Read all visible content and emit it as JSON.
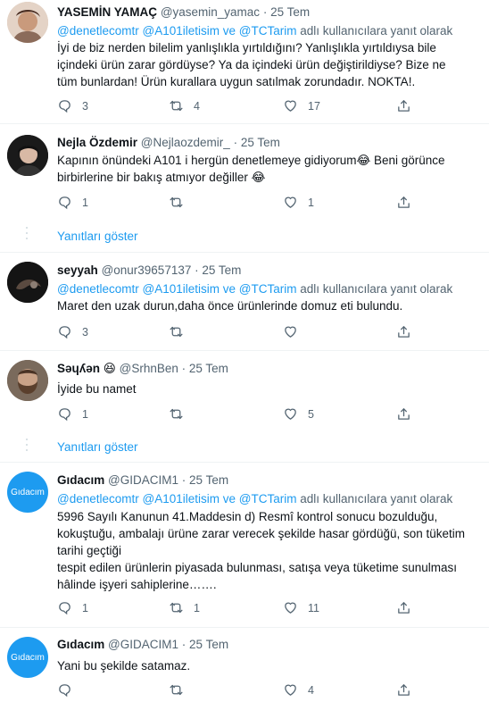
{
  "tweets": [
    {
      "name": "YASEMİN YAMAÇ",
      "handle": "@yasemin_yamac",
      "time": "25 Tem",
      "reply_prefix": "",
      "reply_links": "",
      "reply_suffix": "",
      "lines": [
        "İyi de biz nerden bilelim yanlışlıkla yırtıldığını? Yanlışlıkla yırtıldıysa bile",
        "içindeki ürün zarar gördüyse? Ya da içindeki ürün değiştirildiyse? Bize ne",
        "tüm bunlardan! Ürün kurallara uygun satılmak zorundadır. NOKTA!."
      ],
      "reply_count": "3",
      "retweet_count": "4",
      "like_count": "17"
    },
    {
      "name": "Nejla Özdemir",
      "handle": "@Nejlaozdemir_",
      "time": "25 Tem",
      "lines": [
        "Kapının önündeki A101 i hergün denetlemeye gidiyorum😂 Beni görünce",
        "birbirlerine bir bakış atmıyor değiller 😂"
      ],
      "reply_count": "1",
      "retweet_count": "",
      "like_count": "1"
    },
    {
      "name": "seyyah",
      "handle": "@onur39657137",
      "time": "25 Tem",
      "reply_links": "@denetlecomtr @A101iletisim ve @TCTarim",
      "reply_suffix": "adlı kullanıcılara yanıt olarak",
      "lines": [
        "Maret den uzak durun,daha önce ürünlerinde domuz eti bulundu."
      ],
      "reply_count": "3",
      "retweet_count": "",
      "like_count": ""
    },
    {
      "name": "Sәɥʎǝn 😆",
      "handle": "@SrhnBen",
      "time": "25 Tem",
      "lines": [
        "İyide bu namet"
      ],
      "reply_count": "1",
      "retweet_count": "",
      "like_count": "5"
    },
    {
      "name": "Gıdacım",
      "handle": "@GIDACIM1",
      "time": "25 Tem",
      "avatar_text": "Gıdacım",
      "reply_links": "@denetlecomtr @A101iletisim ve @TCTarim",
      "reply_suffix": "adlı kullanıcılara yanıt olarak",
      "lines": [
        "5996 Sayılı Kanunun 41.Maddesin d) Resmî kontrol sonucu bozulduğu,",
        "kokuştuğu, ambalajı ürüne zarar verecek şekilde hasar gördüğü, son tüketim",
        "tarihi geçtiği",
        "tespit edilen ürünlerin piyasada bulunması, satışa veya tüketime sunulması",
        "hâlinde işyeri sahiplerine……."
      ],
      "reply_count": "1",
      "retweet_count": "1",
      "like_count": "11"
    },
    {
      "name": "Gıdacım",
      "handle": "@GIDACIM1",
      "time": "25 Tem",
      "avatar_text": "Gıdacım",
      "lines": [
        "Yani bu şekilde satamaz."
      ],
      "reply_count": "",
      "retweet_count": "",
      "like_count": "4"
    }
  ],
  "first_reply_links": "@denetlecomtr @A101iletisim ve @TCTarim",
  "first_reply_suffix": "adlı kullanıcılara yanıt olarak",
  "show_replies_label": "Yanıtları göster",
  "dot": "·",
  "colors": {
    "link": "#1d9bf0",
    "muted": "#536471",
    "text": "#0f1419",
    "divider": "#eff3f4",
    "gidacim_avatar": "#1d9bf0"
  }
}
